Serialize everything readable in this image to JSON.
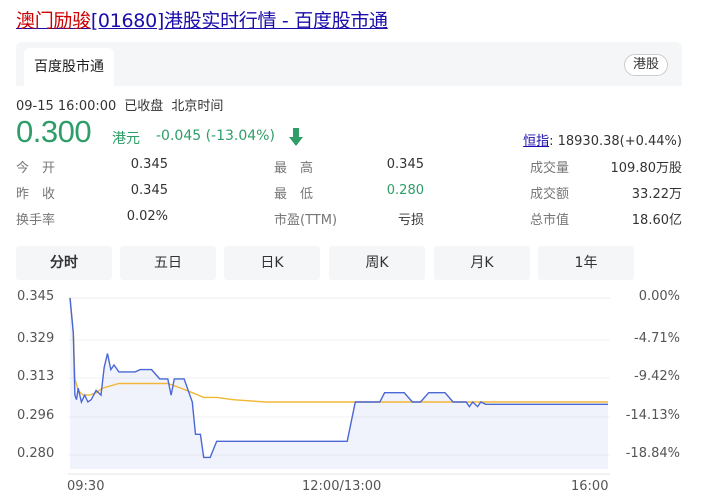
{
  "header": {
    "title_name": "澳门励骏",
    "title_rest": "[01680]港股实时行情 - 百度股市通"
  },
  "tabs": {
    "active_label": "百度股市通",
    "market_badge": "港股"
  },
  "status": {
    "datetime": "09-15 16:00:00",
    "state": "已收盘",
    "zone": "北京时间"
  },
  "quote": {
    "price": "0.300",
    "currency": "港元",
    "change": "-0.045 (-13.04%)",
    "index_label": "恒指",
    "index_value": ": 18930.38(+0.44%)"
  },
  "stats": [
    {
      "label": "今　开",
      "value": "0.345"
    },
    {
      "label": "最　高",
      "value": "0.345"
    },
    {
      "label": "成交量",
      "value": "109.80万股"
    },
    {
      "label": "昨　收",
      "value": "0.345"
    },
    {
      "label": "最　低",
      "value": "0.280"
    },
    {
      "label": "成交额",
      "value": "33.22万"
    },
    {
      "label": "换手率",
      "value": "0.02%"
    },
    {
      "label": "市盈(TTM)",
      "value": "亏损"
    },
    {
      "label": "总市值",
      "value": "18.60亿"
    }
  ],
  "periods": [
    "分时",
    "五日",
    "日K",
    "周K",
    "月K",
    "1年"
  ],
  "colors": {
    "down": "#2e9d68",
    "price_line": "#4a67d6",
    "avg_line": "#f2b736",
    "link": "#1a0dab"
  },
  "chart_data": {
    "type": "line",
    "y_ticks": [
      "0.345",
      "0.329",
      "0.313",
      "0.296",
      "0.280"
    ],
    "y_pct_ticks": [
      "0.00%",
      "-4.71%",
      "-9.42%",
      "-14.13%",
      "-18.84%"
    ],
    "x_ticks": [
      "09:30",
      "12:00/13:00",
      "16:00"
    ],
    "ylim": [
      0.271,
      0.345
    ],
    "x_range": [
      0,
      330
    ],
    "series": [
      {
        "role": "price",
        "points": [
          [
            0,
            0.345
          ],
          [
            2,
            0.33
          ],
          [
            3,
            0.303
          ],
          [
            4,
            0.301
          ],
          [
            5,
            0.306
          ],
          [
            7,
            0.3
          ],
          [
            9,
            0.303
          ],
          [
            11,
            0.3
          ],
          [
            13,
            0.301
          ],
          [
            16,
            0.305
          ],
          [
            19,
            0.303
          ],
          [
            21,
            0.315
          ],
          [
            23,
            0.321
          ],
          [
            25,
            0.314
          ],
          [
            27,
            0.316
          ],
          [
            30,
            0.313
          ],
          [
            40,
            0.313
          ],
          [
            43,
            0.314
          ],
          [
            50,
            0.314
          ],
          [
            55,
            0.31
          ],
          [
            60,
            0.31
          ],
          [
            62,
            0.303
          ],
          [
            64,
            0.31
          ],
          [
            70,
            0.31
          ],
          [
            75,
            0.3
          ],
          [
            77,
            0.286
          ],
          [
            80,
            0.286
          ],
          [
            82,
            0.276
          ],
          [
            86,
            0.276
          ],
          [
            90,
            0.283
          ],
          [
            100,
            0.283
          ],
          [
            110,
            0.283
          ],
          [
            125,
            0.283
          ],
          [
            130,
            0.283
          ],
          [
            150,
            0.283
          ],
          [
            170,
            0.283
          ],
          [
            175,
            0.3
          ],
          [
            190,
            0.3
          ],
          [
            193,
            0.304
          ],
          [
            200,
            0.304
          ],
          [
            205,
            0.304
          ],
          [
            210,
            0.3
          ],
          [
            215,
            0.3
          ],
          [
            220,
            0.304
          ],
          [
            225,
            0.304
          ],
          [
            230,
            0.304
          ],
          [
            235,
            0.3
          ],
          [
            243,
            0.3
          ],
          [
            245,
            0.298
          ],
          [
            247,
            0.3
          ],
          [
            250,
            0.298
          ],
          [
            252,
            0.3
          ],
          [
            255,
            0.299
          ],
          [
            265,
            0.299
          ],
          [
            280,
            0.299
          ],
          [
            300,
            0.299
          ],
          [
            310,
            0.299
          ],
          [
            330,
            0.299
          ]
        ]
      },
      {
        "role": "average",
        "points": [
          [
            0,
            0.345
          ],
          [
            2,
            0.33
          ],
          [
            3,
            0.31
          ],
          [
            5,
            0.305
          ],
          [
            8,
            0.303
          ],
          [
            12,
            0.303
          ],
          [
            16,
            0.304
          ],
          [
            20,
            0.306
          ],
          [
            25,
            0.307
          ],
          [
            30,
            0.308
          ],
          [
            40,
            0.308
          ],
          [
            50,
            0.308
          ],
          [
            60,
            0.308
          ],
          [
            68,
            0.306
          ],
          [
            75,
            0.304
          ],
          [
            82,
            0.302
          ],
          [
            90,
            0.302
          ],
          [
            100,
            0.301
          ],
          [
            120,
            0.3
          ],
          [
            150,
            0.3
          ],
          [
            170,
            0.3
          ],
          [
            200,
            0.3
          ],
          [
            230,
            0.3
          ],
          [
            260,
            0.3
          ],
          [
            300,
            0.3
          ],
          [
            330,
            0.3
          ]
        ]
      }
    ]
  }
}
